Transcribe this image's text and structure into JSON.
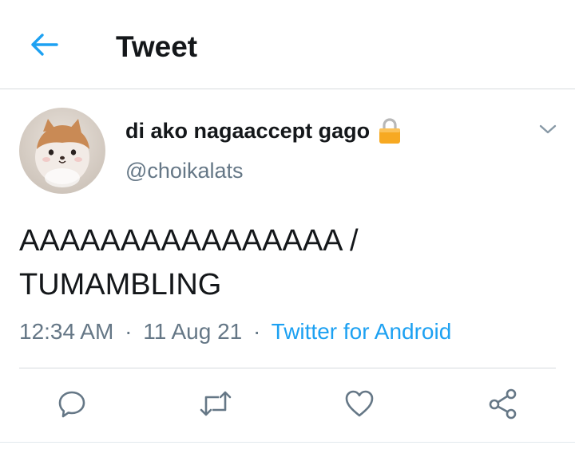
{
  "header": {
    "title": "Tweet",
    "back_icon": "arrow-left-icon"
  },
  "tweet": {
    "author": {
      "display_name": "di ako nagaaccept gago",
      "handle": "@choikalats",
      "protected_icon": "lock-icon",
      "avatar": "plush-toy-avatar"
    },
    "text_line1": "AAAAAAAAAAAAAAAA /",
    "text_line2": "TUMAMBLING",
    "time": "12:34 AM",
    "date": "11 Aug 21",
    "separator": "·",
    "source": "Twitter for Android",
    "actions": [
      {
        "name": "reply",
        "icon": "reply-icon"
      },
      {
        "name": "retweet",
        "icon": "retweet-icon"
      },
      {
        "name": "like",
        "icon": "heart-icon"
      },
      {
        "name": "share",
        "icon": "share-icon"
      }
    ]
  },
  "colors": {
    "accent": "#1da1f2",
    "text_primary": "#14171a",
    "text_secondary": "#657786",
    "divider": "#d6dadd",
    "lock": "#f7a922"
  }
}
